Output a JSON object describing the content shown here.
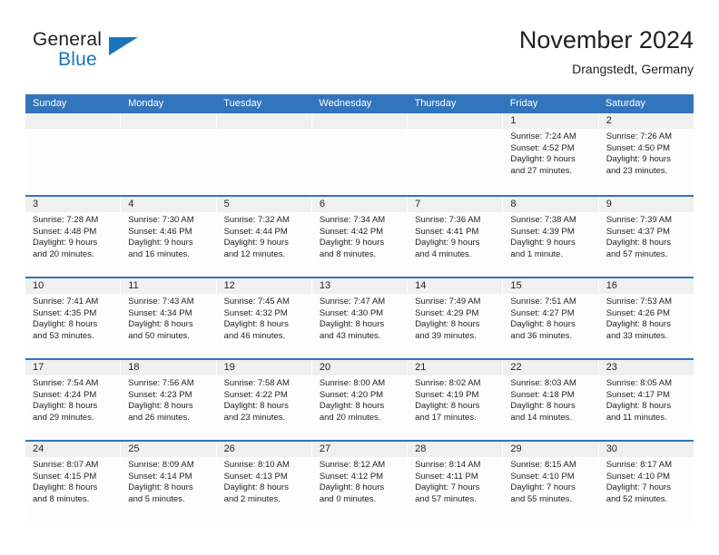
{
  "logo": {
    "text_top": "General",
    "text_bottom": "Blue",
    "triangle_icon": "triangle-icon",
    "color_dark": "#231f20",
    "color_blue": "#1b75bb"
  },
  "header": {
    "title": "November 2024",
    "subtitle": "Drangstedt, Germany"
  },
  "theme": {
    "header_blue": "#3275bd",
    "daynum_band": "#f0f0f0",
    "cell_bg": "#fdfdfd",
    "text": "#231f20"
  },
  "weekdays": [
    "Sunday",
    "Monday",
    "Tuesday",
    "Wednesday",
    "Thursday",
    "Friday",
    "Saturday"
  ],
  "weeks": [
    [
      {
        "day": "",
        "sunrise": "",
        "sunset": "",
        "daylight_line1": "",
        "daylight_line2": ""
      },
      {
        "day": "",
        "sunrise": "",
        "sunset": "",
        "daylight_line1": "",
        "daylight_line2": ""
      },
      {
        "day": "",
        "sunrise": "",
        "sunset": "",
        "daylight_line1": "",
        "daylight_line2": ""
      },
      {
        "day": "",
        "sunrise": "",
        "sunset": "",
        "daylight_line1": "",
        "daylight_line2": ""
      },
      {
        "day": "",
        "sunrise": "",
        "sunset": "",
        "daylight_line1": "",
        "daylight_line2": ""
      },
      {
        "day": "1",
        "sunrise": "Sunrise: 7:24 AM",
        "sunset": "Sunset: 4:52 PM",
        "daylight_line1": "Daylight: 9 hours",
        "daylight_line2": "and 27 minutes."
      },
      {
        "day": "2",
        "sunrise": "Sunrise: 7:26 AM",
        "sunset": "Sunset: 4:50 PM",
        "daylight_line1": "Daylight: 9 hours",
        "daylight_line2": "and 23 minutes."
      }
    ],
    [
      {
        "day": "3",
        "sunrise": "Sunrise: 7:28 AM",
        "sunset": "Sunset: 4:48 PM",
        "daylight_line1": "Daylight: 9 hours",
        "daylight_line2": "and 20 minutes."
      },
      {
        "day": "4",
        "sunrise": "Sunrise: 7:30 AM",
        "sunset": "Sunset: 4:46 PM",
        "daylight_line1": "Daylight: 9 hours",
        "daylight_line2": "and 16 minutes."
      },
      {
        "day": "5",
        "sunrise": "Sunrise: 7:32 AM",
        "sunset": "Sunset: 4:44 PM",
        "daylight_line1": "Daylight: 9 hours",
        "daylight_line2": "and 12 minutes."
      },
      {
        "day": "6",
        "sunrise": "Sunrise: 7:34 AM",
        "sunset": "Sunset: 4:42 PM",
        "daylight_line1": "Daylight: 9 hours",
        "daylight_line2": "and 8 minutes."
      },
      {
        "day": "7",
        "sunrise": "Sunrise: 7:36 AM",
        "sunset": "Sunset: 4:41 PM",
        "daylight_line1": "Daylight: 9 hours",
        "daylight_line2": "and 4 minutes."
      },
      {
        "day": "8",
        "sunrise": "Sunrise: 7:38 AM",
        "sunset": "Sunset: 4:39 PM",
        "daylight_line1": "Daylight: 9 hours",
        "daylight_line2": "and 1 minute."
      },
      {
        "day": "9",
        "sunrise": "Sunrise: 7:39 AM",
        "sunset": "Sunset: 4:37 PM",
        "daylight_line1": "Daylight: 8 hours",
        "daylight_line2": "and 57 minutes."
      }
    ],
    [
      {
        "day": "10",
        "sunrise": "Sunrise: 7:41 AM",
        "sunset": "Sunset: 4:35 PM",
        "daylight_line1": "Daylight: 8 hours",
        "daylight_line2": "and 53 minutes."
      },
      {
        "day": "11",
        "sunrise": "Sunrise: 7:43 AM",
        "sunset": "Sunset: 4:34 PM",
        "daylight_line1": "Daylight: 8 hours",
        "daylight_line2": "and 50 minutes."
      },
      {
        "day": "12",
        "sunrise": "Sunrise: 7:45 AM",
        "sunset": "Sunset: 4:32 PM",
        "daylight_line1": "Daylight: 8 hours",
        "daylight_line2": "and 46 minutes."
      },
      {
        "day": "13",
        "sunrise": "Sunrise: 7:47 AM",
        "sunset": "Sunset: 4:30 PM",
        "daylight_line1": "Daylight: 8 hours",
        "daylight_line2": "and 43 minutes."
      },
      {
        "day": "14",
        "sunrise": "Sunrise: 7:49 AM",
        "sunset": "Sunset: 4:29 PM",
        "daylight_line1": "Daylight: 8 hours",
        "daylight_line2": "and 39 minutes."
      },
      {
        "day": "15",
        "sunrise": "Sunrise: 7:51 AM",
        "sunset": "Sunset: 4:27 PM",
        "daylight_line1": "Daylight: 8 hours",
        "daylight_line2": "and 36 minutes."
      },
      {
        "day": "16",
        "sunrise": "Sunrise: 7:53 AM",
        "sunset": "Sunset: 4:26 PM",
        "daylight_line1": "Daylight: 8 hours",
        "daylight_line2": "and 33 minutes."
      }
    ],
    [
      {
        "day": "17",
        "sunrise": "Sunrise: 7:54 AM",
        "sunset": "Sunset: 4:24 PM",
        "daylight_line1": "Daylight: 8 hours",
        "daylight_line2": "and 29 minutes."
      },
      {
        "day": "18",
        "sunrise": "Sunrise: 7:56 AM",
        "sunset": "Sunset: 4:23 PM",
        "daylight_line1": "Daylight: 8 hours",
        "daylight_line2": "and 26 minutes."
      },
      {
        "day": "19",
        "sunrise": "Sunrise: 7:58 AM",
        "sunset": "Sunset: 4:22 PM",
        "daylight_line1": "Daylight: 8 hours",
        "daylight_line2": "and 23 minutes."
      },
      {
        "day": "20",
        "sunrise": "Sunrise: 8:00 AM",
        "sunset": "Sunset: 4:20 PM",
        "daylight_line1": "Daylight: 8 hours",
        "daylight_line2": "and 20 minutes."
      },
      {
        "day": "21",
        "sunrise": "Sunrise: 8:02 AM",
        "sunset": "Sunset: 4:19 PM",
        "daylight_line1": "Daylight: 8 hours",
        "daylight_line2": "and 17 minutes."
      },
      {
        "day": "22",
        "sunrise": "Sunrise: 8:03 AM",
        "sunset": "Sunset: 4:18 PM",
        "daylight_line1": "Daylight: 8 hours",
        "daylight_line2": "and 14 minutes."
      },
      {
        "day": "23",
        "sunrise": "Sunrise: 8:05 AM",
        "sunset": "Sunset: 4:17 PM",
        "daylight_line1": "Daylight: 8 hours",
        "daylight_line2": "and 11 minutes."
      }
    ],
    [
      {
        "day": "24",
        "sunrise": "Sunrise: 8:07 AM",
        "sunset": "Sunset: 4:15 PM",
        "daylight_line1": "Daylight: 8 hours",
        "daylight_line2": "and 8 minutes."
      },
      {
        "day": "25",
        "sunrise": "Sunrise: 8:09 AM",
        "sunset": "Sunset: 4:14 PM",
        "daylight_line1": "Daylight: 8 hours",
        "daylight_line2": "and 5 minutes."
      },
      {
        "day": "26",
        "sunrise": "Sunrise: 8:10 AM",
        "sunset": "Sunset: 4:13 PM",
        "daylight_line1": "Daylight: 8 hours",
        "daylight_line2": "and 2 minutes."
      },
      {
        "day": "27",
        "sunrise": "Sunrise: 8:12 AM",
        "sunset": "Sunset: 4:12 PM",
        "daylight_line1": "Daylight: 8 hours",
        "daylight_line2": "and 0 minutes."
      },
      {
        "day": "28",
        "sunrise": "Sunrise: 8:14 AM",
        "sunset": "Sunset: 4:11 PM",
        "daylight_line1": "Daylight: 7 hours",
        "daylight_line2": "and 57 minutes."
      },
      {
        "day": "29",
        "sunrise": "Sunrise: 8:15 AM",
        "sunset": "Sunset: 4:10 PM",
        "daylight_line1": "Daylight: 7 hours",
        "daylight_line2": "and 55 minutes."
      },
      {
        "day": "30",
        "sunrise": "Sunrise: 8:17 AM",
        "sunset": "Sunset: 4:10 PM",
        "daylight_line1": "Daylight: 7 hours",
        "daylight_line2": "and 52 minutes."
      }
    ]
  ]
}
